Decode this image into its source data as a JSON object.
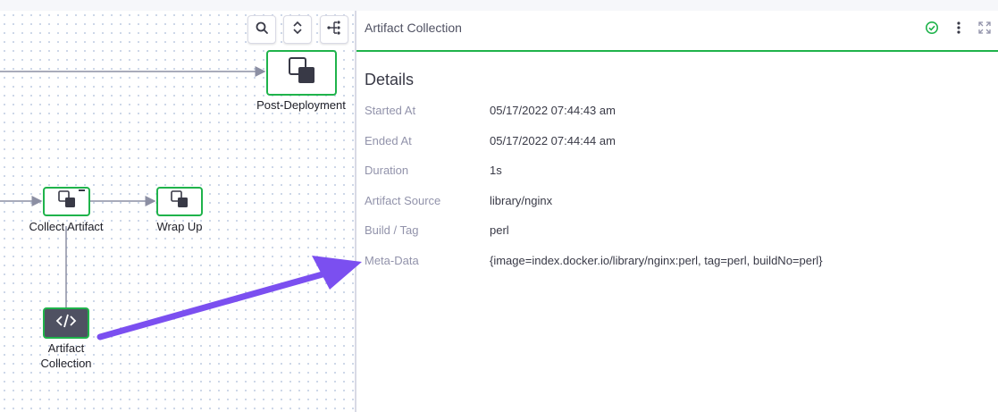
{
  "panel": {
    "title": "Artifact Collection",
    "section_title": "Details",
    "status": "success",
    "rows": [
      {
        "label": "Started At",
        "value": "05/17/2022 07:44:43 am"
      },
      {
        "label": "Ended At",
        "value": "05/17/2022 07:44:44 am"
      },
      {
        "label": "Duration",
        "value": "1s"
      },
      {
        "label": "Artifact Source",
        "value": "library/nginx"
      },
      {
        "label": "Build / Tag",
        "value": "perl"
      },
      {
        "label": "Meta-Data",
        "value": "{image=index.docker.io/library/nginx:perl, tag=perl, buildNo=perl}"
      }
    ]
  },
  "canvas": {
    "tools": [
      "search-icon",
      "expand-collapse-icon",
      "graph-layout-icon"
    ],
    "nodes": {
      "post_deployment": "Post-Deployment",
      "collect_artifact": "Collect Artifact",
      "wrap_up": "Wrap Up",
      "artifact_collection": "Artifact Collection"
    }
  },
  "colors": {
    "success": "#1fb34b",
    "dark_node": "#4f5162",
    "annotation_arrow": "#7b4ff0",
    "edge": "#8c8fa3"
  }
}
